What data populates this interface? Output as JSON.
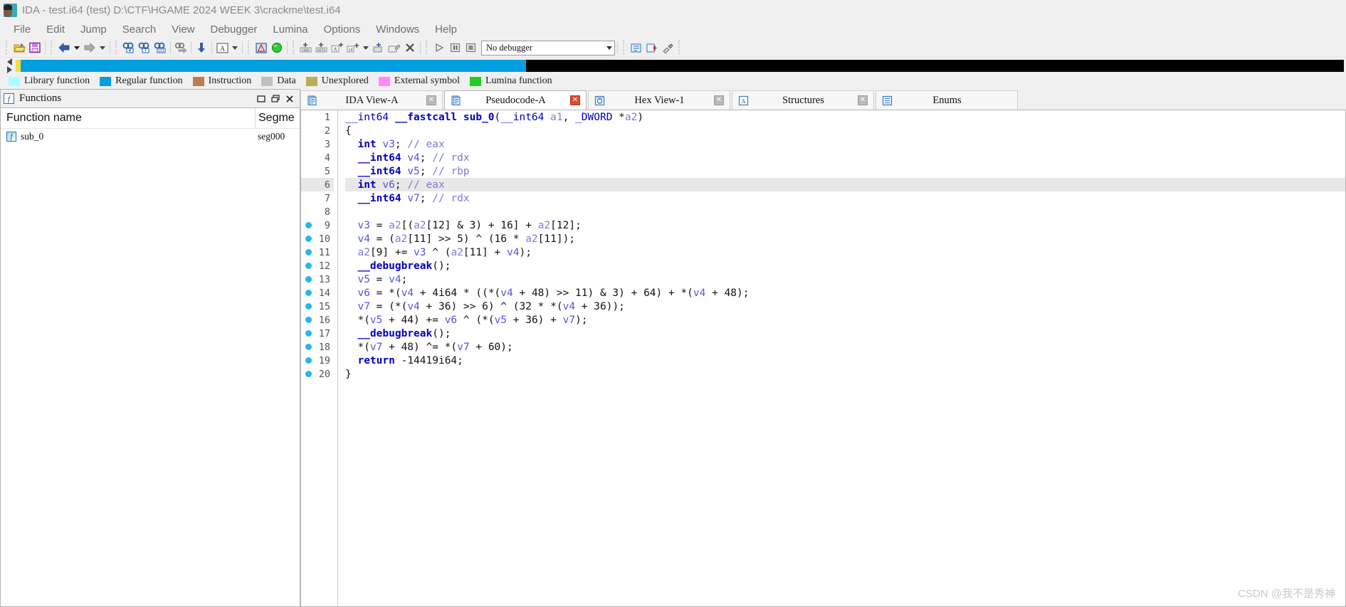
{
  "window": {
    "title": "IDA - test.i64 (test) D:\\CTF\\HGAME 2024 WEEK 3\\crackme\\test.i64",
    "app_icon": "ida-logo-icon"
  },
  "menu": {
    "items": [
      {
        "label": "File"
      },
      {
        "label": "Edit"
      },
      {
        "label": "Jump"
      },
      {
        "label": "Search"
      },
      {
        "label": "View"
      },
      {
        "label": "Debugger"
      },
      {
        "label": "Lumina"
      },
      {
        "label": "Options"
      },
      {
        "label": "Windows"
      },
      {
        "label": "Help"
      }
    ]
  },
  "toolbar": {
    "buttons": [
      {
        "name": "open-file-icon"
      },
      {
        "name": "save-icon"
      },
      {
        "name": "back-arrow-icon"
      },
      {
        "name": "back-dropdown-icon"
      },
      {
        "name": "forward-arrow-icon"
      },
      {
        "name": "forward-dropdown-icon"
      },
      {
        "name": "search-hex-icon"
      },
      {
        "name": "search-text-icon"
      },
      {
        "name": "search-sequence-icon"
      },
      {
        "name": "jump-to-icon"
      },
      {
        "name": "jump-down-icon"
      },
      {
        "name": "strings-icon"
      },
      {
        "name": "strings-dropdown-icon"
      },
      {
        "name": "warning-icon"
      },
      {
        "name": "graph-ok-icon"
      },
      {
        "name": "make-code-icon"
      },
      {
        "name": "make-data-icon"
      },
      {
        "name": "make-ascii-icon"
      },
      {
        "name": "make-struct-icon"
      },
      {
        "name": "make-struct-dropdown-icon"
      },
      {
        "name": "undefine-icon"
      },
      {
        "name": "edit-function-icon"
      },
      {
        "name": "delete-function-icon"
      },
      {
        "name": "run-icon"
      },
      {
        "name": "pause-icon"
      },
      {
        "name": "stop-icon"
      }
    ],
    "debugger_select": {
      "value": "No debugger",
      "name": "debugger-select"
    },
    "right_buttons": [
      {
        "name": "lumina-pull-icon"
      },
      {
        "name": "lumina-push-icon"
      },
      {
        "name": "plugin-1-icon"
      },
      {
        "name": "plugin-2-icon"
      },
      {
        "name": "plugin-3-icon"
      }
    ]
  },
  "navband": {
    "segments": [
      {
        "color": "#f5de3a",
        "width_pct": 0.4
      },
      {
        "color": "#00a0e0",
        "width_pct": 38.0
      },
      {
        "color": "#000000",
        "width_pct": 61.6
      }
    ]
  },
  "legend": {
    "items": [
      {
        "label": "Library function",
        "color": "#aaffff"
      },
      {
        "label": "Regular function",
        "color": "#00a0e0"
      },
      {
        "label": "Instruction",
        "color": "#c07a50"
      },
      {
        "label": "Data",
        "color": "#c0c0c0"
      },
      {
        "label": "Unexplored",
        "color": "#b5b055"
      },
      {
        "label": "External symbol",
        "color": "#ff88ff"
      },
      {
        "label": "Lumina function",
        "color": "#22cc22"
      }
    ]
  },
  "functions_panel": {
    "title": "Functions",
    "icon": "function-panel-icon",
    "window_buttons": [
      {
        "name": "restore-window-button",
        "glyph": "❐"
      },
      {
        "name": "maximize-window-button",
        "glyph": "❐"
      },
      {
        "name": "close-window-button",
        "glyph": "✕"
      }
    ],
    "columns": [
      "Function name",
      "Segme"
    ],
    "rows": [
      {
        "name": "sub_0",
        "segment": "seg000",
        "icon": "function-icon"
      }
    ]
  },
  "tabs": [
    {
      "label": "IDA View-A",
      "icon": "document-icon",
      "active": false,
      "close_style": "grey"
    },
    {
      "label": "Pseudocode-A",
      "icon": "document-icon",
      "active": true,
      "close_style": "red"
    },
    {
      "label": "Hex View-1",
      "icon": "hex-icon",
      "active": false,
      "close_style": "grey"
    },
    {
      "label": "Structures",
      "icon": "structures-icon",
      "active": false,
      "close_style": "grey"
    },
    {
      "label": "Enums",
      "icon": "enums-icon",
      "active": false,
      "close_style": "none"
    }
  ],
  "pseudocode": {
    "lines": [
      {
        "n": 1,
        "bp": false,
        "hl": false,
        "tokens": [
          {
            "t": "type",
            "s": "__int64"
          },
          {
            "t": "plain",
            "s": " "
          },
          {
            "t": "kw",
            "s": "__fastcall"
          },
          {
            "t": "plain",
            "s": " "
          },
          {
            "t": "fn",
            "s": "sub_0"
          },
          {
            "t": "plain",
            "s": "("
          },
          {
            "t": "type",
            "s": "__int64"
          },
          {
            "t": "plain",
            "s": " "
          },
          {
            "t": "arg",
            "s": "a1"
          },
          {
            "t": "plain",
            "s": ", "
          },
          {
            "t": "type",
            "s": "_DWORD"
          },
          {
            "t": "plain",
            "s": " *"
          },
          {
            "t": "arg",
            "s": "a2"
          },
          {
            "t": "plain",
            "s": ")"
          }
        ]
      },
      {
        "n": 2,
        "bp": false,
        "hl": false,
        "tokens": [
          {
            "t": "plain",
            "s": "{"
          }
        ]
      },
      {
        "n": 3,
        "bp": false,
        "hl": false,
        "tokens": [
          {
            "t": "plain",
            "s": "  "
          },
          {
            "t": "kw",
            "s": "int"
          },
          {
            "t": "plain",
            "s": " "
          },
          {
            "t": "var",
            "s": "v3"
          },
          {
            "t": "plain",
            "s": "; "
          },
          {
            "t": "cmt",
            "s": "// eax"
          }
        ]
      },
      {
        "n": 4,
        "bp": false,
        "hl": false,
        "tokens": [
          {
            "t": "plain",
            "s": "  "
          },
          {
            "t": "kw",
            "s": "__int64"
          },
          {
            "t": "plain",
            "s": " "
          },
          {
            "t": "var",
            "s": "v4"
          },
          {
            "t": "plain",
            "s": "; "
          },
          {
            "t": "cmt",
            "s": "// rdx"
          }
        ]
      },
      {
        "n": 5,
        "bp": false,
        "hl": false,
        "tokens": [
          {
            "t": "plain",
            "s": "  "
          },
          {
            "t": "kw",
            "s": "__int64"
          },
          {
            "t": "plain",
            "s": " "
          },
          {
            "t": "var",
            "s": "v5"
          },
          {
            "t": "plain",
            "s": "; "
          },
          {
            "t": "cmt",
            "s": "// rbp"
          }
        ]
      },
      {
        "n": 6,
        "bp": false,
        "hl": true,
        "tokens": [
          {
            "t": "plain",
            "s": "  "
          },
          {
            "t": "kw",
            "s": "int"
          },
          {
            "t": "plain",
            "s": " "
          },
          {
            "t": "var",
            "s": "v6"
          },
          {
            "t": "plain",
            "s": "; "
          },
          {
            "t": "cmt",
            "s": "// eax"
          }
        ]
      },
      {
        "n": 7,
        "bp": false,
        "hl": false,
        "tokens": [
          {
            "t": "plain",
            "s": "  "
          },
          {
            "t": "kw",
            "s": "__int64"
          },
          {
            "t": "plain",
            "s": " "
          },
          {
            "t": "var",
            "s": "v7"
          },
          {
            "t": "plain",
            "s": "; "
          },
          {
            "t": "cmt",
            "s": "// rdx"
          }
        ]
      },
      {
        "n": 8,
        "bp": false,
        "hl": false,
        "tokens": []
      },
      {
        "n": 9,
        "bp": true,
        "hl": false,
        "tokens": [
          {
            "t": "plain",
            "s": "  "
          },
          {
            "t": "var",
            "s": "v3"
          },
          {
            "t": "plain",
            "s": " = "
          },
          {
            "t": "arg",
            "s": "a2"
          },
          {
            "t": "plain",
            "s": "[("
          },
          {
            "t": "arg",
            "s": "a2"
          },
          {
            "t": "plain",
            "s": "[12] & 3) + 16] + "
          },
          {
            "t": "arg",
            "s": "a2"
          },
          {
            "t": "plain",
            "s": "[12];"
          }
        ]
      },
      {
        "n": 10,
        "bp": true,
        "hl": false,
        "tokens": [
          {
            "t": "plain",
            "s": "  "
          },
          {
            "t": "var",
            "s": "v4"
          },
          {
            "t": "plain",
            "s": " = ("
          },
          {
            "t": "arg",
            "s": "a2"
          },
          {
            "t": "plain",
            "s": "[11] >> 5) ^ (16 * "
          },
          {
            "t": "arg",
            "s": "a2"
          },
          {
            "t": "plain",
            "s": "[11]);"
          }
        ]
      },
      {
        "n": 11,
        "bp": true,
        "hl": false,
        "tokens": [
          {
            "t": "plain",
            "s": "  "
          },
          {
            "t": "arg",
            "s": "a2"
          },
          {
            "t": "plain",
            "s": "[9] += "
          },
          {
            "t": "var",
            "s": "v3"
          },
          {
            "t": "plain",
            "s": " ^ ("
          },
          {
            "t": "arg",
            "s": "a2"
          },
          {
            "t": "plain",
            "s": "[11] + "
          },
          {
            "t": "var",
            "s": "v4"
          },
          {
            "t": "plain",
            "s": ");"
          }
        ]
      },
      {
        "n": 12,
        "bp": true,
        "hl": false,
        "tokens": [
          {
            "t": "plain",
            "s": "  "
          },
          {
            "t": "fn",
            "s": "__debugbreak"
          },
          {
            "t": "plain",
            "s": "();"
          }
        ]
      },
      {
        "n": 13,
        "bp": true,
        "hl": false,
        "tokens": [
          {
            "t": "plain",
            "s": "  "
          },
          {
            "t": "var",
            "s": "v5"
          },
          {
            "t": "plain",
            "s": " = "
          },
          {
            "t": "var",
            "s": "v4"
          },
          {
            "t": "plain",
            "s": ";"
          }
        ]
      },
      {
        "n": 14,
        "bp": true,
        "hl": false,
        "tokens": [
          {
            "t": "plain",
            "s": "  "
          },
          {
            "t": "var",
            "s": "v6"
          },
          {
            "t": "plain",
            "s": " = *("
          },
          {
            "t": "var",
            "s": "v4"
          },
          {
            "t": "plain",
            "s": " + 4i64 * ((*("
          },
          {
            "t": "var",
            "s": "v4"
          },
          {
            "t": "plain",
            "s": " + 48) >> 11) & 3) + 64) + *("
          },
          {
            "t": "var",
            "s": "v4"
          },
          {
            "t": "plain",
            "s": " + 48);"
          }
        ]
      },
      {
        "n": 15,
        "bp": true,
        "hl": false,
        "tokens": [
          {
            "t": "plain",
            "s": "  "
          },
          {
            "t": "var",
            "s": "v7"
          },
          {
            "t": "plain",
            "s": " = (*("
          },
          {
            "t": "var",
            "s": "v4"
          },
          {
            "t": "plain",
            "s": " + 36) >> 6) ^ (32 * *("
          },
          {
            "t": "var",
            "s": "v4"
          },
          {
            "t": "plain",
            "s": " + 36));"
          }
        ]
      },
      {
        "n": 16,
        "bp": true,
        "hl": false,
        "tokens": [
          {
            "t": "plain",
            "s": "  *("
          },
          {
            "t": "var",
            "s": "v5"
          },
          {
            "t": "plain",
            "s": " + 44) += "
          },
          {
            "t": "var",
            "s": "v6"
          },
          {
            "t": "plain",
            "s": " ^ (*("
          },
          {
            "t": "var",
            "s": "v5"
          },
          {
            "t": "plain",
            "s": " + 36) + "
          },
          {
            "t": "var",
            "s": "v7"
          },
          {
            "t": "plain",
            "s": ");"
          }
        ]
      },
      {
        "n": 17,
        "bp": true,
        "hl": false,
        "tokens": [
          {
            "t": "plain",
            "s": "  "
          },
          {
            "t": "fn",
            "s": "__debugbreak"
          },
          {
            "t": "plain",
            "s": "();"
          }
        ]
      },
      {
        "n": 18,
        "bp": true,
        "hl": false,
        "tokens": [
          {
            "t": "plain",
            "s": "  *("
          },
          {
            "t": "var",
            "s": "v7"
          },
          {
            "t": "plain",
            "s": " + 48) ^= *("
          },
          {
            "t": "var",
            "s": "v7"
          },
          {
            "t": "plain",
            "s": " + 60);"
          }
        ]
      },
      {
        "n": 19,
        "bp": true,
        "hl": false,
        "tokens": [
          {
            "t": "plain",
            "s": "  "
          },
          {
            "t": "kw",
            "s": "return"
          },
          {
            "t": "plain",
            "s": " -14419i64;"
          }
        ]
      },
      {
        "n": 20,
        "bp": true,
        "hl": false,
        "tokens": [
          {
            "t": "plain",
            "s": "}"
          }
        ]
      }
    ]
  },
  "watermark": "CSDN @我不是秀神"
}
